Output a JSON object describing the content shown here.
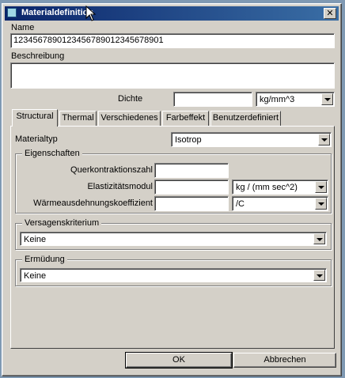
{
  "window": {
    "title": "Materialdefinition",
    "close_glyph": "✕"
  },
  "name": {
    "label": "Name",
    "value": "1234567890123456789012345678901"
  },
  "description": {
    "label": "Beschreibung",
    "value": ""
  },
  "density": {
    "label": "Dichte",
    "value": "",
    "unit": "kg/mm^3"
  },
  "tabs": [
    {
      "label": "Structural"
    },
    {
      "label": "Thermal"
    },
    {
      "label": "Verschiedenes"
    },
    {
      "label": "Farbeffekt"
    },
    {
      "label": "Benutzerdefiniert"
    }
  ],
  "material_type": {
    "label": "Materialtyp",
    "value": "Isotrop"
  },
  "properties": {
    "group_label": "Eigenschaften",
    "poisson": {
      "label": "Querkontraktionszahl",
      "value": ""
    },
    "youngs": {
      "label": "Elastizitätsmodul",
      "value": "",
      "unit": "kg / (mm sec^2)"
    },
    "thermal_expansion": {
      "label": "Wärmeausdehnungskoeffizient",
      "value": "",
      "unit": "/C"
    }
  },
  "failure": {
    "group_label": "Versagenskriterium",
    "value": "Keine"
  },
  "fatigue": {
    "group_label": "Ermüdung",
    "value": "Keine"
  },
  "buttons": {
    "ok": "OK",
    "cancel": "Abbrechen"
  }
}
